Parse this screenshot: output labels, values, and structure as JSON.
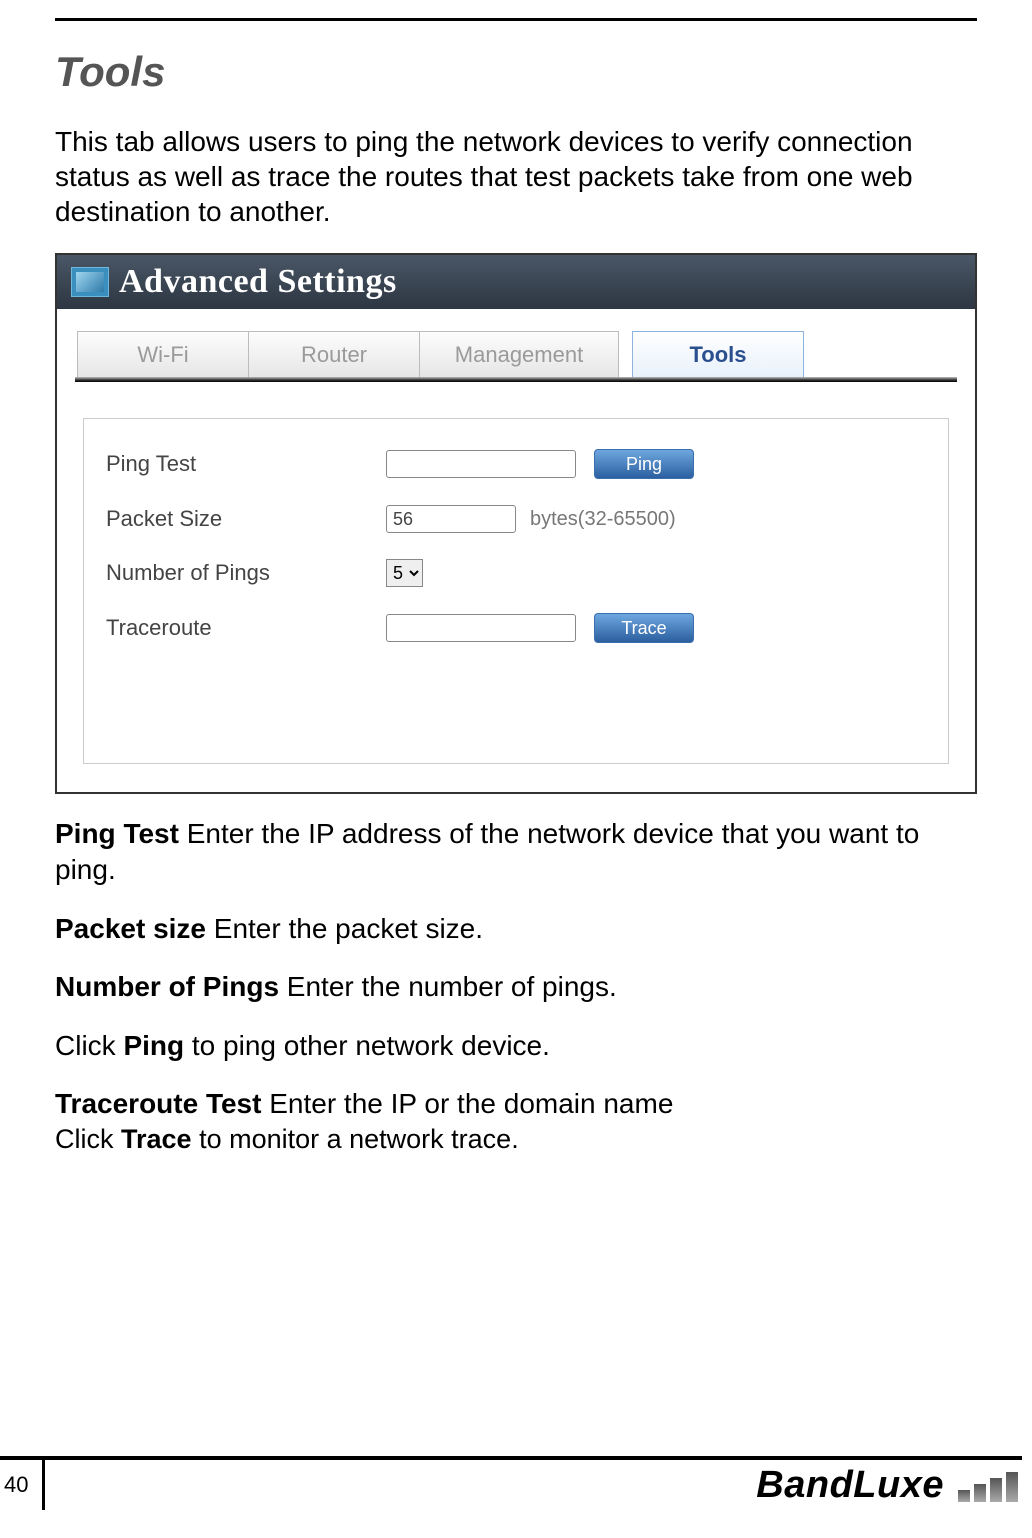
{
  "section_title": "Tools",
  "intro_text": "This tab allows users to ping the network devices to verify connection status as well as trace the routes that test packets take from one web destination to another.",
  "screenshot": {
    "header_title": "Advanced Settings",
    "tabs": {
      "wifi": "Wi-Fi",
      "router": "Router",
      "management": "Management",
      "tools": "Tools"
    },
    "form": {
      "ping_test_label": "Ping Test",
      "ping_test_value": "",
      "ping_button": "Ping",
      "packet_size_label": "Packet Size",
      "packet_size_value": "56",
      "packet_size_hint": "bytes(32-65500)",
      "num_pings_label": "Number of Pings",
      "num_pings_value": "5",
      "traceroute_label": "Traceroute",
      "traceroute_value": "",
      "trace_button": "Trace"
    }
  },
  "descriptions": {
    "ping_test_b": "Ping Test",
    "ping_test_t": " Enter the IP address of the network device that you want to ping.",
    "packet_size_b": "Packet size",
    "packet_size_t": " Enter the packet size.",
    "num_pings_b": "Number of Pings",
    "num_pings_t": " Enter the number of pings.",
    "click_ping_pre": "Click ",
    "click_ping_b": "Ping",
    "click_ping_post": " to ping other network device.",
    "traceroute_b": "Traceroute Test",
    "traceroute_t": " Enter the IP or the domain name",
    "trace_pre": "Click ",
    "trace_b": "Trace",
    "trace_post": " to monitor a network trace."
  },
  "footer": {
    "page_number": "40",
    "brand": "BandLuxe"
  }
}
